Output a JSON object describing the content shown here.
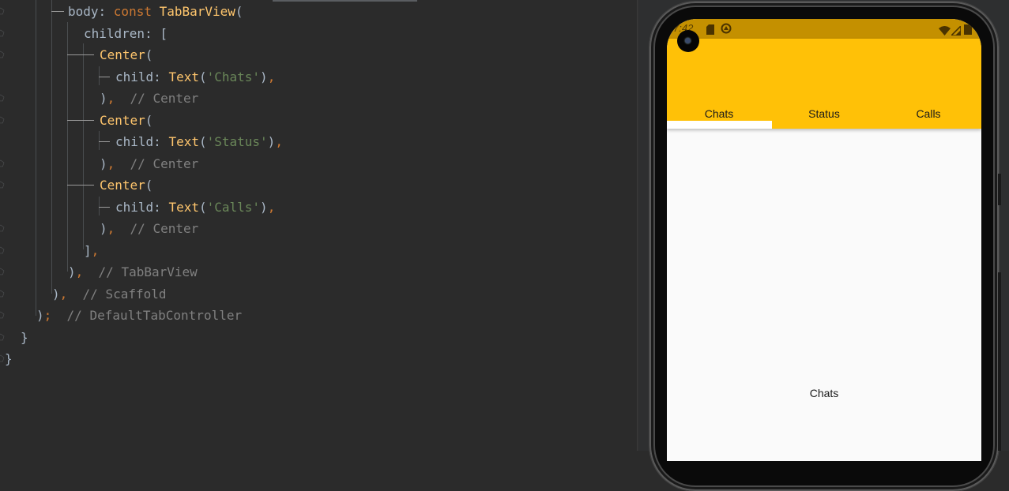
{
  "editor": {
    "lines": [
      {
        "indent": "        ",
        "parts": [
          [
            "br",
            "body: "
          ],
          [
            "kw",
            "const "
          ],
          [
            "cls",
            "TabBarView"
          ],
          [
            "br",
            "("
          ]
        ]
      },
      {
        "indent": "          ",
        "parts": [
          [
            "br",
            "children: ["
          ]
        ]
      },
      {
        "indent": "            ",
        "parts": [
          [
            "cls",
            "Center"
          ],
          [
            "br",
            "("
          ]
        ]
      },
      {
        "indent": "              ",
        "parts": [
          [
            "br",
            "child: "
          ],
          [
            "cls",
            "Text"
          ],
          [
            "br",
            "("
          ],
          [
            "str",
            "'Chats'"
          ],
          [
            "br",
            ")"
          ],
          [
            "pn",
            ","
          ]
        ]
      },
      {
        "indent": "            ",
        "parts": [
          [
            "br",
            ")"
          ],
          [
            "pn",
            ","
          ],
          [
            "cmt",
            "  // Center"
          ]
        ]
      },
      {
        "indent": "            ",
        "parts": [
          [
            "cls",
            "Center"
          ],
          [
            "br",
            "("
          ]
        ]
      },
      {
        "indent": "              ",
        "parts": [
          [
            "br",
            "child: "
          ],
          [
            "cls",
            "Text"
          ],
          [
            "br",
            "("
          ],
          [
            "str",
            "'Status'"
          ],
          [
            "br",
            ")"
          ],
          [
            "pn",
            ","
          ]
        ]
      },
      {
        "indent": "            ",
        "parts": [
          [
            "br",
            ")"
          ],
          [
            "pn",
            ","
          ],
          [
            "cmt",
            "  // Center"
          ]
        ]
      },
      {
        "indent": "            ",
        "parts": [
          [
            "cls",
            "Center"
          ],
          [
            "br",
            "("
          ]
        ]
      },
      {
        "indent": "              ",
        "parts": [
          [
            "br",
            "child: "
          ],
          [
            "cls",
            "Text"
          ],
          [
            "br",
            "("
          ],
          [
            "str",
            "'Calls'"
          ],
          [
            "br",
            ")"
          ],
          [
            "pn",
            ","
          ]
        ]
      },
      {
        "indent": "            ",
        "parts": [
          [
            "br",
            ")"
          ],
          [
            "pn",
            ","
          ],
          [
            "cmt",
            "  // Center"
          ]
        ]
      },
      {
        "indent": "          ",
        "parts": [
          [
            "br",
            "]"
          ],
          [
            "pn",
            ","
          ]
        ]
      },
      {
        "indent": "        ",
        "parts": [
          [
            "br",
            ")"
          ],
          [
            "pn",
            ","
          ],
          [
            "cmt",
            "  // TabBarView"
          ]
        ]
      },
      {
        "indent": "      ",
        "parts": [
          [
            "br",
            ")"
          ],
          [
            "pn",
            ","
          ],
          [
            "cmt",
            "  // Scaffold"
          ]
        ]
      },
      {
        "indent": "    ",
        "parts": [
          [
            "br",
            ")"
          ],
          [
            "pn",
            ";"
          ],
          [
            "cmt",
            "  // DefaultTabController"
          ]
        ]
      },
      {
        "indent": "  ",
        "parts": [
          [
            "br",
            "}"
          ]
        ]
      },
      {
        "indent": "",
        "parts": [
          [
            "br",
            "}"
          ]
        ]
      }
    ]
  },
  "phone": {
    "status_bar": {
      "time": "7:42",
      "left_icons": [
        "sd-card-icon",
        "sync-icon"
      ],
      "right_icons": [
        "wifi-icon",
        "signal-icon",
        "battery-icon"
      ]
    },
    "tabs": [
      {
        "label": "Chats",
        "selected": true
      },
      {
        "label": "Status",
        "selected": false
      },
      {
        "label": "Calls",
        "selected": false
      }
    ],
    "content_text": "Chats",
    "colors": {
      "app_bar": "#FFC107",
      "status_bar": "#C49000",
      "indicator": "#FFFFFF",
      "background": "#FAFAFA"
    }
  }
}
